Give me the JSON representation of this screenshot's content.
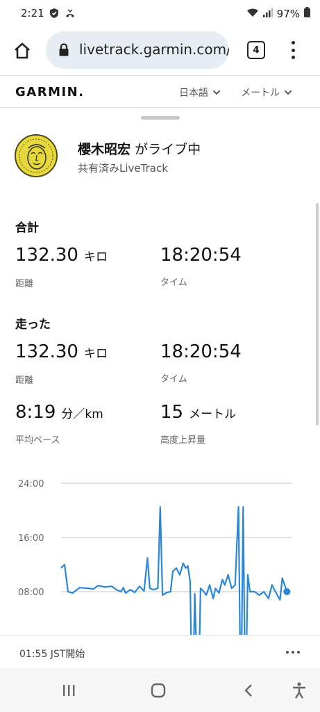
{
  "status": {
    "time": "2:21",
    "battery": "97%",
    "icons": [
      "shield-icon",
      "missed-call-icon",
      "wifi-icon",
      "signal-icon",
      "battery-icon"
    ]
  },
  "browser": {
    "url": "livetrack.garmin.com/",
    "tab_count": "4",
    "icons": [
      "home-icon",
      "lock-icon",
      "more-vert-icon"
    ]
  },
  "header": {
    "logo": "GARMIN.",
    "language": "日本語",
    "units": "メートル",
    "icons": [
      "chevron-down-icon"
    ]
  },
  "profile": {
    "name": "櫻木昭宏",
    "status_suffix": "がライブ中",
    "shared_label": "共有済みLiveTrack"
  },
  "totals": {
    "title": "合計",
    "distance_value": "132.30",
    "distance_unit": "キロ",
    "distance_label": "距離",
    "time_value": "18:20:54",
    "time_label": "タイム"
  },
  "run": {
    "title": "走った",
    "distance_value": "132.30",
    "distance_unit": "キロ",
    "distance_label": "距離",
    "time_value": "18:20:54",
    "time_label": "タイム",
    "pace_value": "8:19",
    "pace_unit": "分／km",
    "pace_label": "平均ペース",
    "elevation_value": "15",
    "elevation_unit": "メートル",
    "elevation_label": "高度上昇量"
  },
  "chart_data": {
    "type": "line",
    "y_tick_labels": [
      "24:00",
      "16:00",
      "08:00"
    ],
    "y_ticks": [
      24,
      16,
      8
    ],
    "ylim": [
      0,
      26
    ],
    "xlim": [
      0,
      100
    ],
    "grid": true,
    "color": "#2a86d8",
    "series": [
      {
        "values": [
          [
            0,
            11.5
          ],
          [
            1.5,
            12.0
          ],
          [
            3,
            8.0
          ],
          [
            5,
            7.8
          ],
          [
            8,
            8.6
          ],
          [
            12,
            8.5
          ],
          [
            14,
            8.4
          ],
          [
            16,
            8.9
          ],
          [
            19,
            8.7
          ],
          [
            22,
            8.8
          ],
          [
            24,
            8.3
          ],
          [
            26,
            8.0
          ],
          [
            27,
            8.6
          ],
          [
            28,
            7.8
          ],
          [
            30,
            8.3
          ],
          [
            32,
            7.9
          ],
          [
            34,
            8.8
          ],
          [
            36,
            8.1
          ],
          [
            37.5,
            13.0
          ],
          [
            38.5,
            8.5
          ],
          [
            40,
            8.3
          ],
          [
            42,
            8.5
          ],
          [
            43,
            20.5
          ],
          [
            44,
            7.5
          ],
          [
            46,
            7.9
          ],
          [
            47.5,
            8.0
          ],
          [
            48.5,
            11.0
          ],
          [
            50,
            11.5
          ],
          [
            51.5,
            10.5
          ],
          [
            53,
            12.2
          ],
          [
            54,
            11.5
          ],
          [
            55,
            11.8
          ],
          [
            56,
            9.5
          ],
          [
            57,
            -10
          ],
          [
            58,
            7.7
          ],
          [
            59.5,
            -10
          ],
          [
            60.5,
            8.5
          ],
          [
            62,
            8.0
          ],
          [
            63,
            7.5
          ],
          [
            64.5,
            9.0
          ],
          [
            66,
            7.0
          ],
          [
            67,
            8.5
          ],
          [
            68.5,
            7.8
          ],
          [
            70,
            9.8
          ],
          [
            71,
            9.0
          ],
          [
            72.5,
            10.5
          ],
          [
            74,
            8.5
          ],
          [
            75.5,
            9.0
          ],
          [
            77,
            20.5
          ],
          [
            78,
            -10
          ],
          [
            79,
            20.5
          ],
          [
            80,
            -10
          ],
          [
            81,
            10.5
          ],
          [
            82,
            8.0
          ],
          [
            84,
            8.0
          ],
          [
            86,
            7.5
          ],
          [
            88,
            8.0
          ],
          [
            90,
            7.0
          ],
          [
            91.5,
            9.0
          ],
          [
            93,
            8.0
          ],
          [
            95,
            6.8
          ],
          [
            96,
            10.0
          ],
          [
            98,
            8.0
          ]
        ]
      }
    ]
  },
  "footer": {
    "start_text": "01:55 JST開始",
    "icons": [
      "more-horiz-icon"
    ]
  },
  "nav": {
    "icons": [
      "recent-apps-icon",
      "home-button-icon",
      "back-icon",
      "accessibility-icon"
    ]
  }
}
